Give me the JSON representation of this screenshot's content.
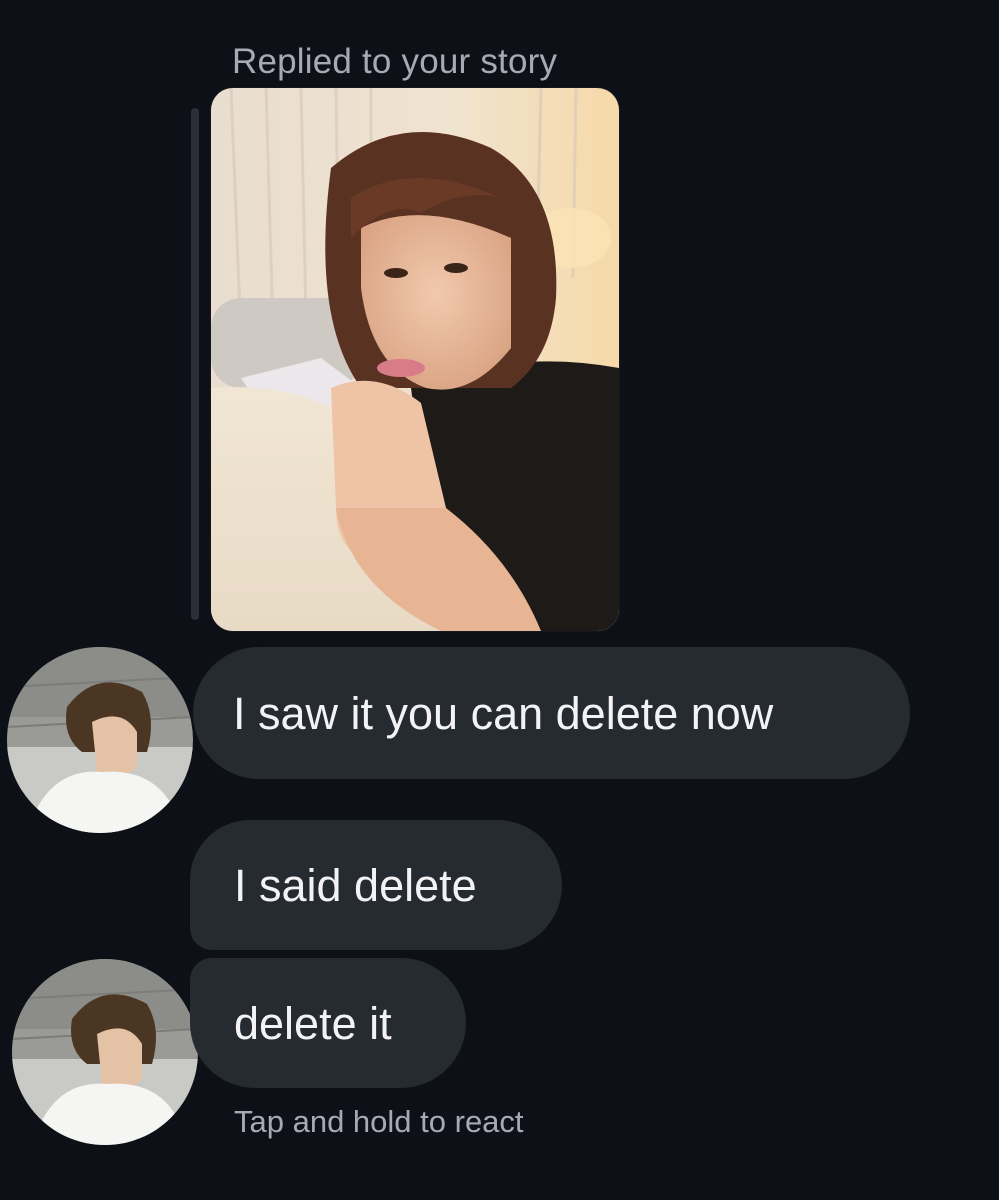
{
  "thread": {
    "reply_label": "Replied to your story",
    "story_media": "story-photo",
    "messages": [
      {
        "text": "I saw it you can delete now",
        "has_avatar": true
      },
      {
        "text": "I said delete",
        "has_avatar": false
      },
      {
        "text": "delete it",
        "has_avatar": true
      }
    ],
    "hint": "Tap and hold to react"
  },
  "colors": {
    "background": "#0d1117",
    "bubble": "#262a31",
    "message_text": "#f3f3f5",
    "secondary_text": "#a7aab3",
    "reply_bar": "#2a2e37"
  },
  "icons": [
    "sender-avatar",
    "story-photo"
  ]
}
